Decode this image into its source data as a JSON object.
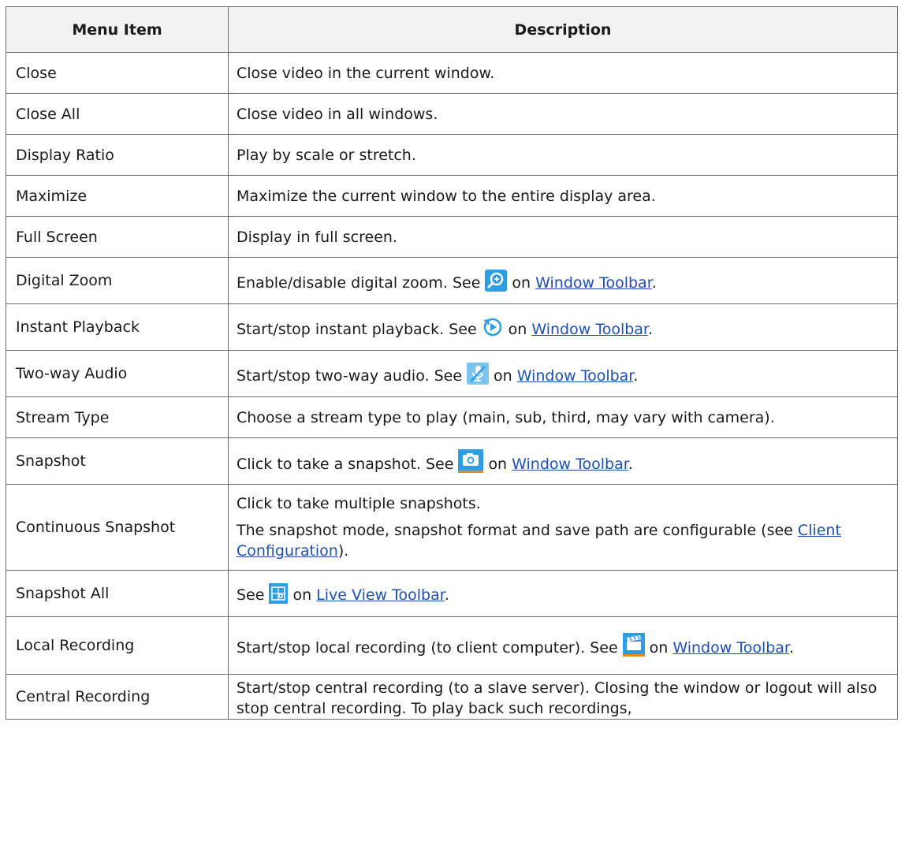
{
  "header": {
    "col1": "Menu Item",
    "col2": "Description"
  },
  "rows": [
    {
      "item": "Close",
      "desc": "Close video in the current window."
    },
    {
      "item": "Close All",
      "desc": "Close video in all windows."
    },
    {
      "item": "Display Ratio",
      "desc": "Play by scale or stretch."
    },
    {
      "item": "Maximize",
      "desc": "Maximize the current window to the entire display area."
    },
    {
      "item": "Full Screen",
      "desc": "Display in full screen."
    },
    {
      "item": "Digital Zoom",
      "pre": "Enable/disable digital zoom. See",
      "icon": "digital-zoom-icon",
      "on": "on",
      "link": "Window Toolbar",
      "post": "."
    },
    {
      "item": "Instant Playback",
      "pre": "Start/stop instant playback. See",
      "icon": "instant-playback-icon",
      "on": "on",
      "link": "Window Toolbar",
      "post": "."
    },
    {
      "item": "Two-way Audio",
      "pre": "Start/stop two-way audio. See",
      "icon": "two-way-audio-icon",
      "on": "on",
      "link": "Window Toolbar",
      "post": "."
    },
    {
      "item": "Stream Type",
      "desc": "Choose a stream type to play (main, sub, third, may vary with camera)."
    },
    {
      "item": "Snapshot",
      "pre": "Click to take a snapshot. See",
      "icon": "camera-icon",
      "on": "on",
      "link": "Window Toolbar",
      "post": "."
    },
    {
      "item": "Continuous Snapshot",
      "p1": "Click to take multiple snapshots.",
      "p2_pre": "The snapshot mode, snapshot format and save path are configurable (see",
      "link": "Client Configuration",
      "p2_post": ")."
    },
    {
      "item": "Snapshot All",
      "pre": "See",
      "icon": "snapshot-all-icon",
      "on": "on",
      "link": "Live View Toolbar",
      "post": "."
    },
    {
      "item": "Local Recording",
      "pre": "Start/stop local recording (to client computer). See",
      "icon": "local-recording-icon",
      "on": "on",
      "link": "Window Toolbar",
      "post": "."
    },
    {
      "item": "Central Recording",
      "desc": "Start/stop central recording (to a slave server). Closing the window or logout will also stop central recording. To play back such recordings,"
    }
  ],
  "colors": {
    "icon_blue": "#2f9de4",
    "link": "#1f4fb5",
    "header_bg": "#f2f2f2",
    "border": "#6b6b6b"
  }
}
